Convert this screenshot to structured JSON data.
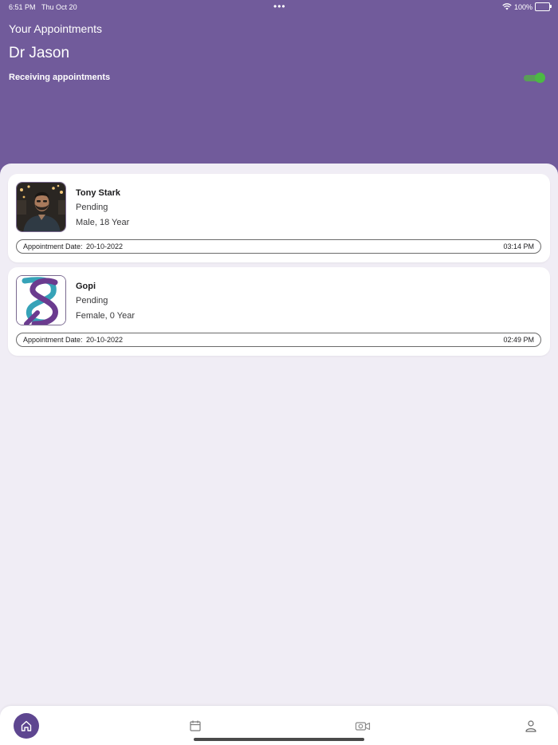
{
  "status_bar": {
    "time": "6:51 PM",
    "date": "Thu Oct 20",
    "dots": "•••",
    "battery_percent": "100%",
    "wifi_icon": "wifi-icon",
    "battery_icon": "battery-icon"
  },
  "header": {
    "title": "Your Appointments",
    "doctor_name": "Dr Jason",
    "receiving_label": "Receiving appointments",
    "receiving_enabled": true,
    "background_color": "#715b9b",
    "toggle_color": "#4cb944"
  },
  "appointments": [
    {
      "name": "Tony Stark",
      "status": "Pending",
      "info": "Male, 18 Year",
      "date_label": "Appointment Date:",
      "date": "20-10-2022",
      "time": "03:14 PM",
      "avatar": "photo-avatar"
    },
    {
      "name": "Gopi",
      "status": "Pending",
      "info": "Female, 0 Year",
      "date_label": "Appointment Date:",
      "date": "20-10-2022",
      "time": "02:49 PM",
      "avatar": "logo-avatar"
    }
  ],
  "tabbar": {
    "tabs": [
      {
        "icon": "home-icon",
        "active": true
      },
      {
        "icon": "calendar-icon",
        "active": false
      },
      {
        "icon": "video-camera-icon",
        "active": false
      },
      {
        "icon": "profile-icon",
        "active": false
      }
    ],
    "active_color": "#5e4690"
  }
}
